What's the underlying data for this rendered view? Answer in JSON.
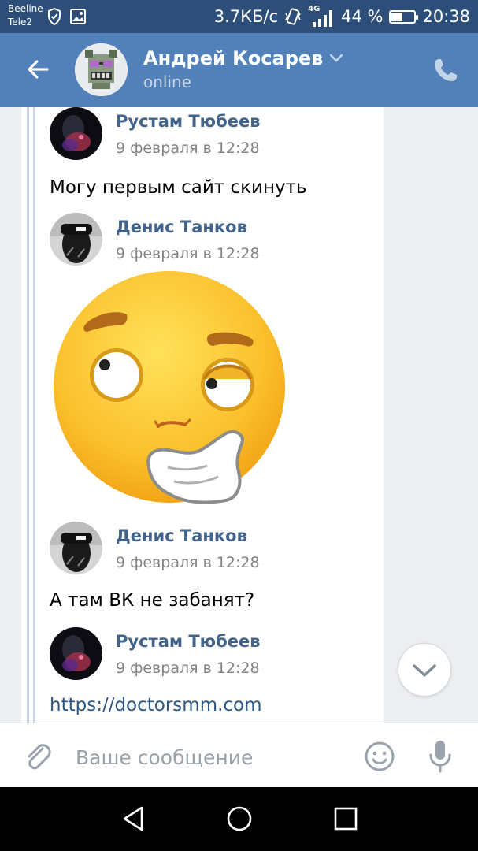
{
  "status_bar": {
    "carrier_1": "Beeline",
    "carrier_2": "Tele2",
    "network_speed": "3.7КБ/с",
    "network_type": "4G",
    "battery_percent": "44 %",
    "battery_level": 0.44,
    "time": "20:38",
    "icons": [
      "shield-icon",
      "gallery-icon",
      "vibrate-icon",
      "signal-icon",
      "battery-icon"
    ]
  },
  "header": {
    "contact_name": "Андрей Косарев",
    "contact_status": "online",
    "icons": [
      "back-arrow-icon",
      "chevron-down-icon",
      "phone-icon"
    ]
  },
  "messages": [
    {
      "author": "Рустам Тюбеев",
      "date": "9 февраля в 12:28",
      "text": "Могу первым сайт скинуть"
    },
    {
      "author": "Денис Танков",
      "date": "9 февраля в 12:28",
      "sticker": "thinking-face-sticker"
    },
    {
      "author": "Денис Танков",
      "date": "9 февраля в 12:28",
      "text": "А там ВК не забанят?"
    },
    {
      "author": "Рустам Тюбеев",
      "date": "9 февраля в 12:28",
      "link": "https://doctorsmm.com"
    }
  ],
  "composer": {
    "placeholder": "Ваше сообщение",
    "icons": [
      "paperclip-icon",
      "emoji-icon",
      "microphone-icon"
    ]
  },
  "nav_bar": {
    "icons": [
      "back-triangle-icon",
      "home-circle-icon",
      "recents-square-icon"
    ]
  },
  "colors": {
    "status_bar": "#2c4e78",
    "header": "#5181b8",
    "author_name": "#42648b",
    "link": "#2a5885",
    "background": "#edeef0"
  }
}
